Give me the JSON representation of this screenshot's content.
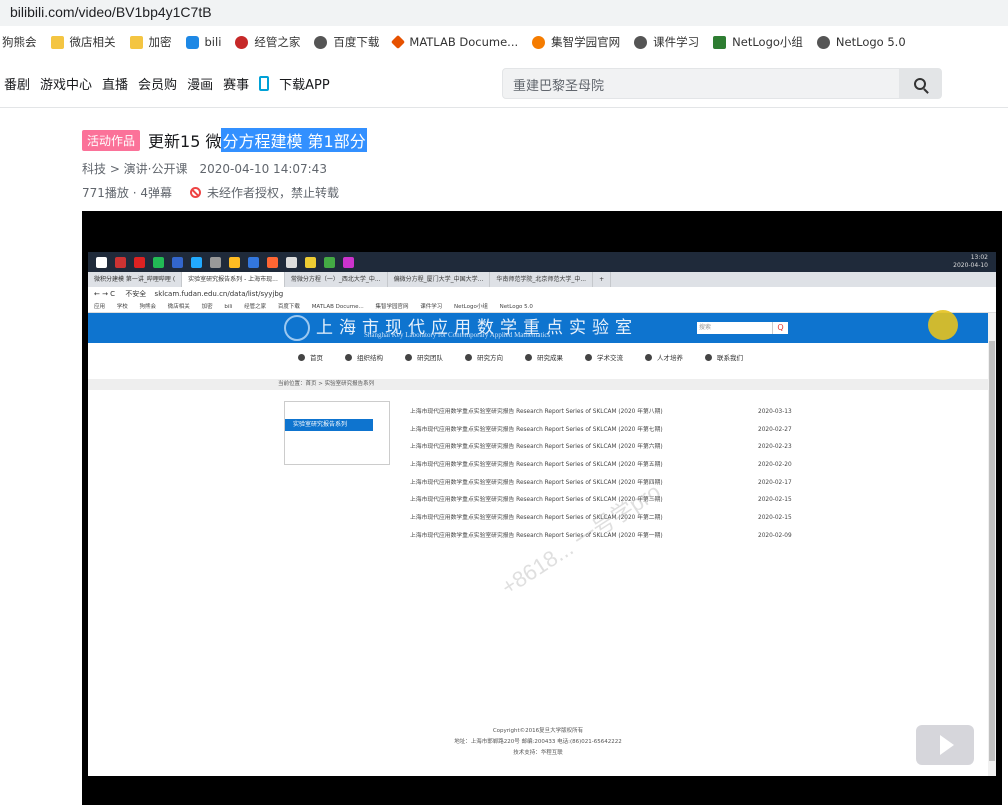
{
  "browser": {
    "url": "bilibili.com/video/BV1bp4y1C7tB"
  },
  "bookmarks": [
    {
      "label": "狗熊会",
      "icon": "none"
    },
    {
      "label": "微店相关",
      "icon": "folder"
    },
    {
      "label": "加密",
      "icon": "folder"
    },
    {
      "label": "bili",
      "icon": "bilibili-icon"
    },
    {
      "label": "经管之家",
      "icon": "red-circle"
    },
    {
      "label": "百度下载",
      "icon": "globe"
    },
    {
      "label": "MATLAB Docume...",
      "icon": "matlab"
    },
    {
      "label": "集智学园官网",
      "icon": "orange-circle"
    },
    {
      "label": "课件学习",
      "icon": "globe"
    },
    {
      "label": "NetLogo小组",
      "icon": "douban"
    },
    {
      "label": "NetLogo 5.0",
      "icon": "globe"
    }
  ],
  "nav": {
    "links": [
      "番剧",
      "游戏中心",
      "直播",
      "会员购",
      "漫画",
      "赛事"
    ],
    "app_label": "下载APP",
    "search_value": "重建巴黎圣母院"
  },
  "video": {
    "badge": "活动作品",
    "title_plain": "更新15 微",
    "title_selected": "分方程建模 第1部分",
    "category": "科技 > 演讲·公开课",
    "datetime": "2020-04-10 14:07:43",
    "stats": "771播放 · 4弹幕",
    "copyright": "未经作者授权，禁止转载"
  },
  "screen": {
    "clock_time": "13:02",
    "clock_date": "2020-04-10",
    "tabs": [
      "微积分建模 第一讲_哔哩哔哩 (",
      "实验室研究报告系列 - 上海市现...",
      "常微分方程（一）_西北大学_中...",
      "偏微分方程_厦门大学_中国大学...",
      "华南师范学院_北京师范大学_中..."
    ],
    "insecure_label": "不安全",
    "url": "sklcam.fudan.edu.cn/data/list/syyjbg",
    "bookmarks": [
      "应用",
      "学校",
      "狗熊会",
      "微店相关",
      "加密",
      "bili",
      "经管之家",
      "百度下载",
      "MATLAB Docume...",
      "集智学园官网",
      "课件学习",
      "NetLogo小组",
      "NetLogo 5.0"
    ],
    "site_title_cn": "上海市现代应用数学重点实验室",
    "site_title_en": "Shanghai Key Laboratory for Contemporary Applied Mathematics",
    "site_search": "搜索",
    "menu": [
      "首页",
      "组织结构",
      "研究团队",
      "研究方向",
      "研究成果",
      "学术交流",
      "人才培养",
      "联系我们"
    ],
    "breadcrumb": "当前位置：首页 > 实验室研究报告系列",
    "side_active": "实验室研究报告系列",
    "reports": [
      {
        "title": "上海市现代应用数学重点实验室研究报告 Research Report Series of SKLCAM (2020 年第八期)",
        "date": "2020-03-13"
      },
      {
        "title": "上海市现代应用数学重点实验室研究报告 Research Report Series of SKLCAM (2020 年第七期)",
        "date": "2020-02-27"
      },
      {
        "title": "上海市现代应用数学重点实验室研究报告 Research Report Series of SKLCAM (2020 年第六期)",
        "date": "2020-02-23"
      },
      {
        "title": "上海市现代应用数学重点实验室研究报告 Research Report Series of SKLCAM (2020 年第五期)",
        "date": "2020-02-20"
      },
      {
        "title": "上海市现代应用数学重点实验室研究报告 Research Report Series of SKLCAM (2020 年第四期)",
        "date": "2020-02-17"
      },
      {
        "title": "上海市现代应用数学重点实验室研究报告 Research Report Series of SKLCAM (2020 年第三期)",
        "date": "2020-02-15"
      },
      {
        "title": "上海市现代应用数学重点实验室研究报告 Research Report Series of SKLCAM (2020 年第二期)",
        "date": "2020-02-15"
      },
      {
        "title": "上海市现代应用数学重点实验室研究报告 Research Report Series of SKLCAM (2020 年第一期)",
        "date": "2020-02-09"
      }
    ],
    "footer_copyright": "Copyright©2016复旦大学版权所有",
    "footer_address": "地址：上海市邯郸路220号 邮编:200433 电话:(86)021-65642222",
    "footer_support": "技术支持：华程互联",
    "watermark": "+8618... 一号学pro"
  },
  "colors": {
    "bili_pink": "#fb7299",
    "selection_blue": "#3390ff",
    "site_blue": "#0e74cf"
  }
}
